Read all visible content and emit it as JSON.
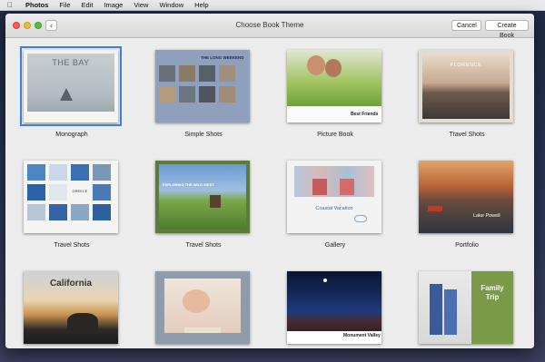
{
  "menubar": {
    "apple_icon": "apple-icon",
    "items": [
      "Photos",
      "File",
      "Edit",
      "Image",
      "View",
      "Window",
      "Help"
    ]
  },
  "window": {
    "title": "Choose Book Theme",
    "back_icon": "chevron-left-icon",
    "cancel_label": "Cancel",
    "create_label": "Create Book",
    "selection_color": "#3a7fe0"
  },
  "themes": [
    {
      "name": "Monograph",
      "cover_text": "THE BAY",
      "selected": true
    },
    {
      "name": "Simple Shots",
      "cover_text": "THE LONG WEEKEND"
    },
    {
      "name": "Picture Book",
      "cover_text": "Best Friends"
    },
    {
      "name": "Travel Shots",
      "cover_text": "FLORENCE"
    },
    {
      "name": "Travel Shots",
      "cover_text": "GREECE"
    },
    {
      "name": "Travel Shots",
      "cover_text": "EXPLORING THE WILD WEST"
    },
    {
      "name": "Gallery",
      "cover_text": "Coastal Vacation"
    },
    {
      "name": "Portfolio",
      "cover_text": "Lake Powell"
    },
    {
      "name": "",
      "cover_text": "California"
    },
    {
      "name": "",
      "cover_text": ""
    },
    {
      "name": "",
      "cover_text": "Monument Valley"
    },
    {
      "name": "",
      "cover_text": "Family Trip"
    }
  ]
}
